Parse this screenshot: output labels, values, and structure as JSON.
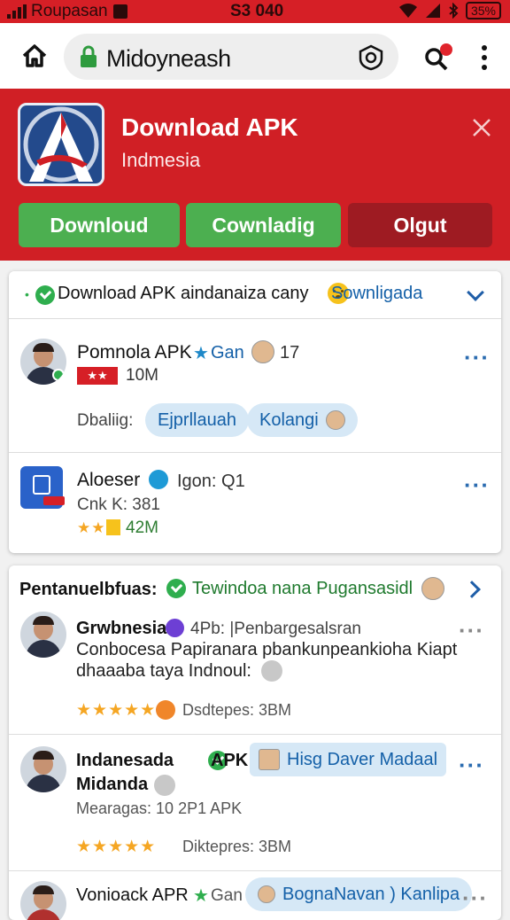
{
  "status_bar": {
    "carrier": "Roupasan",
    "time": "S3 040",
    "battery": "35%"
  },
  "browser": {
    "url": "Midoyneash"
  },
  "banner": {
    "title": "Download APK",
    "subtitle": "Indmesia",
    "buttons": [
      "Downloud",
      "Cownladig",
      "Olgut"
    ]
  },
  "card1": {
    "header_text": "Download APK aindanaiza cany",
    "header_link": "Sownligada",
    "items": [
      {
        "name": "Pomnola APK",
        "tag": "Gan",
        "count": "17",
        "meta": "10M",
        "label": "Dbaliig:",
        "pills": [
          "Ejprllauah",
          "Kolangi"
        ]
      },
      {
        "name": "Aloeser",
        "tag": "Igon: Q1",
        "line2": "Cnk K: 381",
        "meta": "42M"
      }
    ]
  },
  "card2": {
    "header_label": "Pentanuelbfuas:",
    "header_text": "Tewindoa nana Pugansasidl",
    "items": [
      {
        "name": "Grwbnesia",
        "tag": "4Pb: |Penbargesalsran",
        "desc1": "Conbocesa Papiranara pbankunpeankioha Kiapt",
        "desc2": "dhaaaba taya Indnoul:",
        "rating_text": "Dsdtepes: 3BM"
      },
      {
        "name": "Indanesada",
        "name2": "Midanda",
        "tag": "APK",
        "pill": "Hisg Daver Madaal",
        "meta": "Mearagas: 10 2P1 APK",
        "rating_text": "Diktepres: 3BM"
      },
      {
        "name": "Vonioack APR",
        "tag": "Gan",
        "pill": "BognaNavan ) Kanlipa"
      }
    ]
  },
  "colors": {
    "brand_red": "#d01f25",
    "green": "#4caf50",
    "link_blue": "#1460a8"
  }
}
